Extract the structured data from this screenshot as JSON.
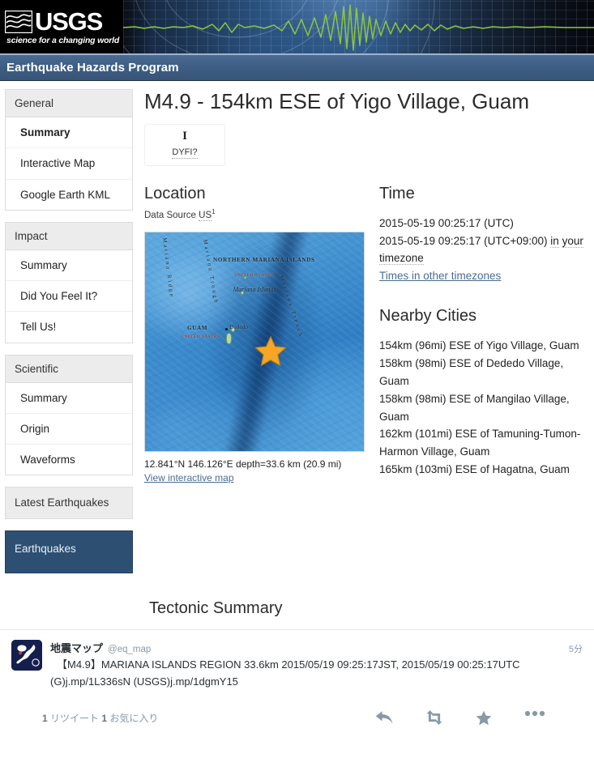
{
  "banner": {
    "logo_name": "USGS",
    "logo_tagline": "science for a changing world",
    "logo_icon": "usgs-wave-logo",
    "seismogram_icon": "seismogram-waveform"
  },
  "program_bar": {
    "title": "Earthquake Hazards Program"
  },
  "sidebar": {
    "groups": [
      {
        "header": "General",
        "items": [
          {
            "label": "Summary",
            "active": true
          },
          {
            "label": "Interactive Map",
            "active": false
          },
          {
            "label": "Google Earth KML",
            "active": false
          }
        ]
      },
      {
        "header": "Impact",
        "items": [
          {
            "label": "Summary",
            "active": false
          },
          {
            "label": "Did You Feel It?",
            "active": false
          },
          {
            "label": "Tell Us!",
            "active": false
          }
        ]
      },
      {
        "header": "Scientific",
        "items": [
          {
            "label": "Summary",
            "active": false
          },
          {
            "label": "Origin",
            "active": false
          },
          {
            "label": "Waveforms",
            "active": false
          }
        ]
      }
    ],
    "latest_label": "Latest Earthquakes",
    "cta_label": "Earthquakes"
  },
  "main": {
    "title": "M4.9 - 154km ESE of Yigo Village, Guam",
    "dyfi": {
      "intensity": "I",
      "label": "DYFI?"
    },
    "location": {
      "heading": "Location",
      "data_source_prefix": "Data Source",
      "data_source_value": "US",
      "data_source_sup": "1",
      "caption": "12.841°N 146.126°E depth=33.6 km (20.9 mi)",
      "map_link": "View interactive map",
      "map": {
        "labels": [
          {
            "text": "NORTHERN MARIANA ISLANDS",
            "type": "country"
          },
          {
            "text": "UNITED STATES",
            "type": "sub"
          },
          {
            "text": "Mariana Islands",
            "type": "italic"
          },
          {
            "text": "GUAM",
            "type": "country"
          },
          {
            "text": "UNITED STATES",
            "type": "sub"
          },
          {
            "text": "Dededo",
            "type": "city"
          },
          {
            "text": "Mariana Trench",
            "type": "feature"
          },
          {
            "text": "Mariana Trough",
            "type": "feature"
          },
          {
            "text": "Mariana Ridge",
            "type": "feature"
          }
        ],
        "epicenter_icon": "epicenter-star"
      }
    },
    "time": {
      "heading": "Time",
      "utc": "2015-05-19 00:25:17 (UTC)",
      "local_prefix": "2015-05-19 09:25:17 (UTC+09:00)",
      "local_suffix_a": "in",
      "local_suffix_b": "your timezone",
      "other_timezones_link": "Times in other timezones"
    },
    "nearby": {
      "heading": "Nearby Cities",
      "cities": [
        "154km (96mi) ESE of Yigo Village, Guam",
        "158km (98mi) ESE of Dededo Village, Guam",
        "158km (98mi) ESE of Mangilao Village, Guam",
        "162km (101mi) ESE of Tamuning-Tumon-Harmon Village, Guam",
        "165km (103mi) ESE of Hagatna, Guam"
      ]
    },
    "tectonic": {
      "heading": "Tectonic Summary"
    }
  },
  "tweet": {
    "avatar_icon": "japan-map-avatar",
    "display_name": "地震マップ",
    "handle": "@eq_map",
    "timestamp": "5分",
    "text_line1": "【M4.9】MARIANA ISLANDS REGION 33.6km 2015/05/19 09:25:17JST, 2015/05/19 00:25:17UTC",
    "text_line2": "(G)j.mp/1L336sN (USGS)j.mp/1dgmY15",
    "retweet_count": "1",
    "retweet_label": "リツイート",
    "favorite_count": "1",
    "favorite_label": "お気に入り",
    "actions": [
      {
        "icon": "reply-icon"
      },
      {
        "icon": "retweet-icon"
      },
      {
        "icon": "favorite-star-icon"
      },
      {
        "icon": "more-ellipsis-icon"
      }
    ]
  },
  "colors": {
    "brand_navy": "#2d4f72",
    "program_bar": "#3f5e85",
    "link": "#4a6d91",
    "star": "#f2a127",
    "twitter_gray": "#8899a6"
  }
}
